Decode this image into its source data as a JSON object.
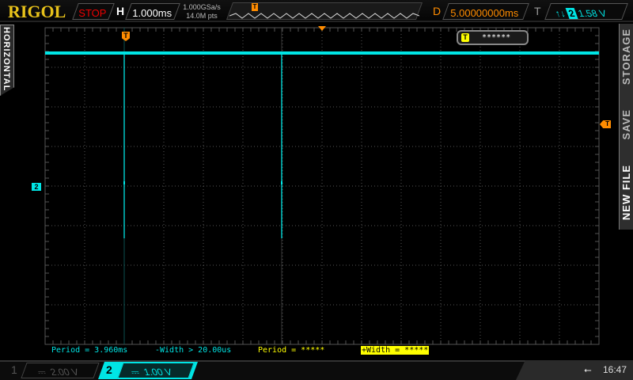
{
  "header": {
    "brand": "RIGOL",
    "run_state": "STOP",
    "timebase_label": "H",
    "timebase": "1.000ms",
    "sample_rate": "1.000GSa/s",
    "memory_depth": "14.0M pts",
    "delay_label": "D",
    "delay": "5.00000000ms",
    "trigger_label": "T",
    "trigger_slope": "↑↓",
    "trigger_channel": "2",
    "trigger_level": "1.58 V"
  },
  "left_tab": {
    "label": "HORIZONTAL"
  },
  "right_menu": {
    "items": [
      "STORAGE",
      "SAVE",
      "NEW FILE"
    ]
  },
  "screen": {
    "trigger_marker": "T",
    "channel_marker": "2",
    "info_box": "******",
    "colors": {
      "ch2": "#00e5e5",
      "trigger": "#ff8c00",
      "grid": "#555555"
    }
  },
  "measurements": [
    {
      "text": "Period = 3.960ms",
      "color": "#00e5e5"
    },
    {
      "text": "-Width > 20.00us",
      "color": "#00e5e5"
    },
    {
      "text": "Period = *****",
      "color": "#ffff00"
    },
    {
      "text": "+Width = *****",
      "color": "#000000"
    }
  ],
  "channels": [
    {
      "number": "1",
      "coupling": "⎓",
      "scale": "2.00 V",
      "active": false
    },
    {
      "number": "2",
      "coupling": "⎓",
      "scale": "1.00 V",
      "active": true
    }
  ],
  "status": {
    "usb_icon": "usb-icon",
    "time": "16:47"
  }
}
